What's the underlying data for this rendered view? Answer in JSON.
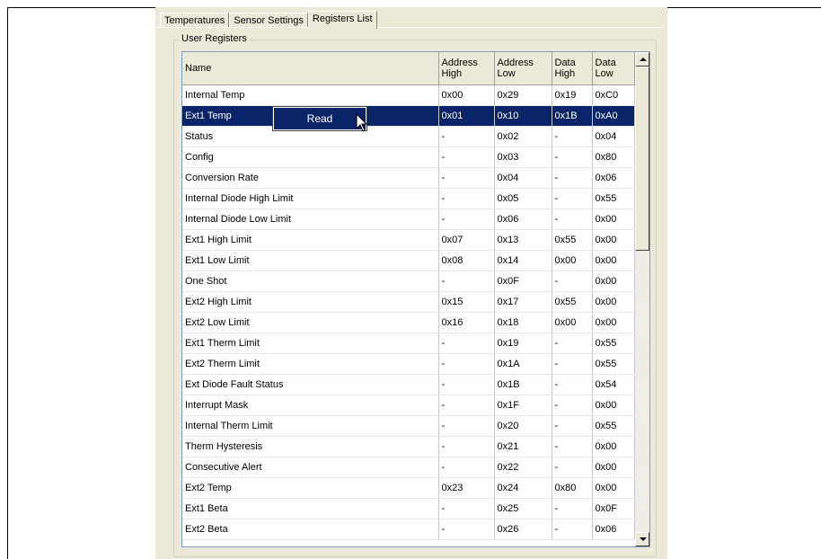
{
  "tabs": [
    {
      "label": "Temperatures",
      "active": false
    },
    {
      "label": "Sensor Settings",
      "active": false
    },
    {
      "label": "Registers List",
      "active": true
    }
  ],
  "group_title": "User Registers",
  "columns": {
    "name": "Name",
    "addr_high": [
      "Address",
      "High"
    ],
    "addr_low": [
      "Address",
      "Low"
    ],
    "data_high": [
      "Data",
      "High"
    ],
    "data_low": [
      "Data",
      "Low"
    ]
  },
  "selected_row": 1,
  "rows": [
    [
      "Internal Temp",
      "0x00",
      "0x29",
      "0x19",
      "0xC0"
    ],
    [
      "Ext1 Temp",
      "0x01",
      "0x10",
      "0x1B",
      "0xA0"
    ],
    [
      "Status",
      "-",
      "0x02",
      "-",
      "0x04"
    ],
    [
      "Config",
      "-",
      "0x03",
      "-",
      "0x80"
    ],
    [
      "Conversion Rate",
      "-",
      "0x04",
      "-",
      "0x06"
    ],
    [
      "Internal Diode High Limit",
      "-",
      "0x05",
      "-",
      "0x55"
    ],
    [
      "Internal Diode Low Limit",
      "-",
      "0x06",
      "-",
      "0x00"
    ],
    [
      "Ext1 High Limit",
      "0x07",
      "0x13",
      "0x55",
      "0x00"
    ],
    [
      "Ext1 Low Limit",
      "0x08",
      "0x14",
      "0x00",
      "0x00"
    ],
    [
      "One Shot",
      "-",
      "0x0F",
      "-",
      "0x00"
    ],
    [
      "Ext2 High Limit",
      "0x15",
      "0x17",
      "0x55",
      "0x00"
    ],
    [
      "Ext2 Low Limit",
      "0x16",
      "0x18",
      "0x00",
      "0x00"
    ],
    [
      "Ext1 Therm Limit",
      "-",
      "0x19",
      "-",
      "0x55"
    ],
    [
      "Ext2 Therm Limit",
      "-",
      "0x1A",
      "-",
      "0x55"
    ],
    [
      "Ext Diode Fault Status",
      "-",
      "0x1B",
      "-",
      "0x54"
    ],
    [
      "Interrupt Mask",
      "-",
      "0x1F",
      "-",
      "0x00"
    ],
    [
      "Internal Therm Limit",
      "-",
      "0x20",
      "-",
      "0x55"
    ],
    [
      "Therm Hysteresis",
      "-",
      "0x21",
      "-",
      "0x00"
    ],
    [
      "Consecutive Alert",
      "-",
      "0x22",
      "-",
      "0x00"
    ],
    [
      "Ext2 Temp",
      "0x23",
      "0x24",
      "0x80",
      "0x00"
    ],
    [
      "Ext1 Beta",
      "-",
      "0x25",
      "-",
      "0x0F"
    ],
    [
      "Ext2 Beta",
      "-",
      "0x26",
      "-",
      "0x06"
    ]
  ],
  "context_menu": {
    "items": [
      "Read"
    ]
  },
  "icons": {
    "scroll_up": "up-arrow-icon",
    "scroll_down": "down-arrow-icon",
    "cursor": "mouse-pointer-icon"
  }
}
